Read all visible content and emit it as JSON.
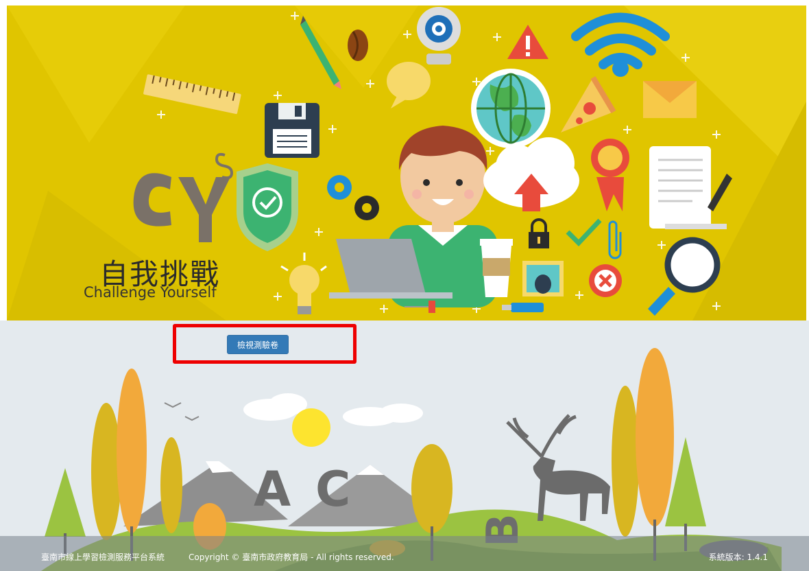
{
  "hero": {
    "title_zh": "自我挑戰",
    "title_en": "Challenge Yourself",
    "logo_letters": "CYs",
    "background_color": "#e0c500"
  },
  "actions": {
    "view_exam_label": "檢視測驗卷",
    "button_color": "#337ab7",
    "highlight_color": "#ee0000"
  },
  "scenery": {
    "letters": [
      "A",
      "C",
      "B"
    ]
  },
  "footer": {
    "site_name": "臺南市線上學習檢測服務平台系統",
    "copyright": "Copyright © 臺南市政府教育局 - All rights reserved.",
    "version": "系統版本: 1.4.1"
  }
}
